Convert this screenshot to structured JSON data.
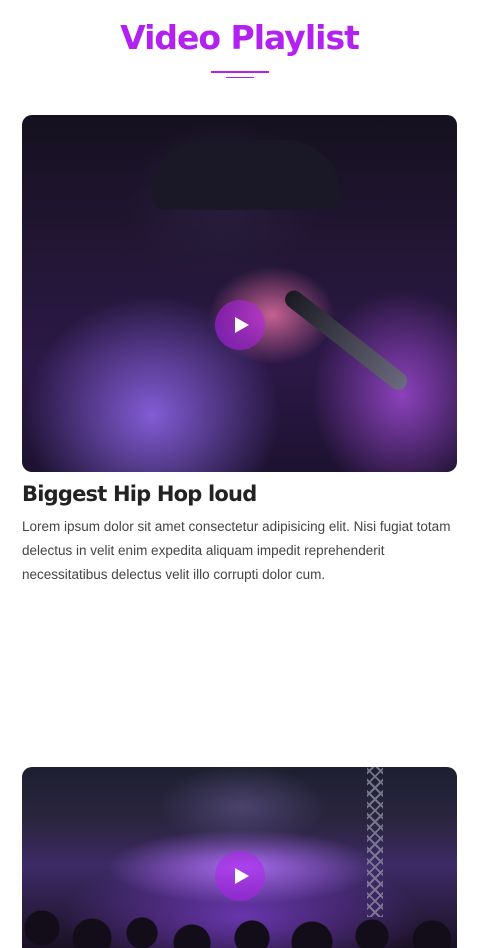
{
  "page": {
    "title": "Video Playlist",
    "accent_color": "#b221f0"
  },
  "videos": [
    {
      "title": "Biggest Hip Hop loud",
      "description": "Lorem ipsum dolor sit amet consectetur adipisicing elit. Nisi fugiat totam delectus in velit enim expedita aliquam impedit reprehenderit necessitatibus delectus velit illo corrupti dolor cum.",
      "thumbnail_icon": "rapper-with-microphone-image",
      "play_icon": "play-icon"
    },
    {
      "thumbnail_icon": "concert-crowd-image",
      "play_icon": "play-icon"
    }
  ]
}
